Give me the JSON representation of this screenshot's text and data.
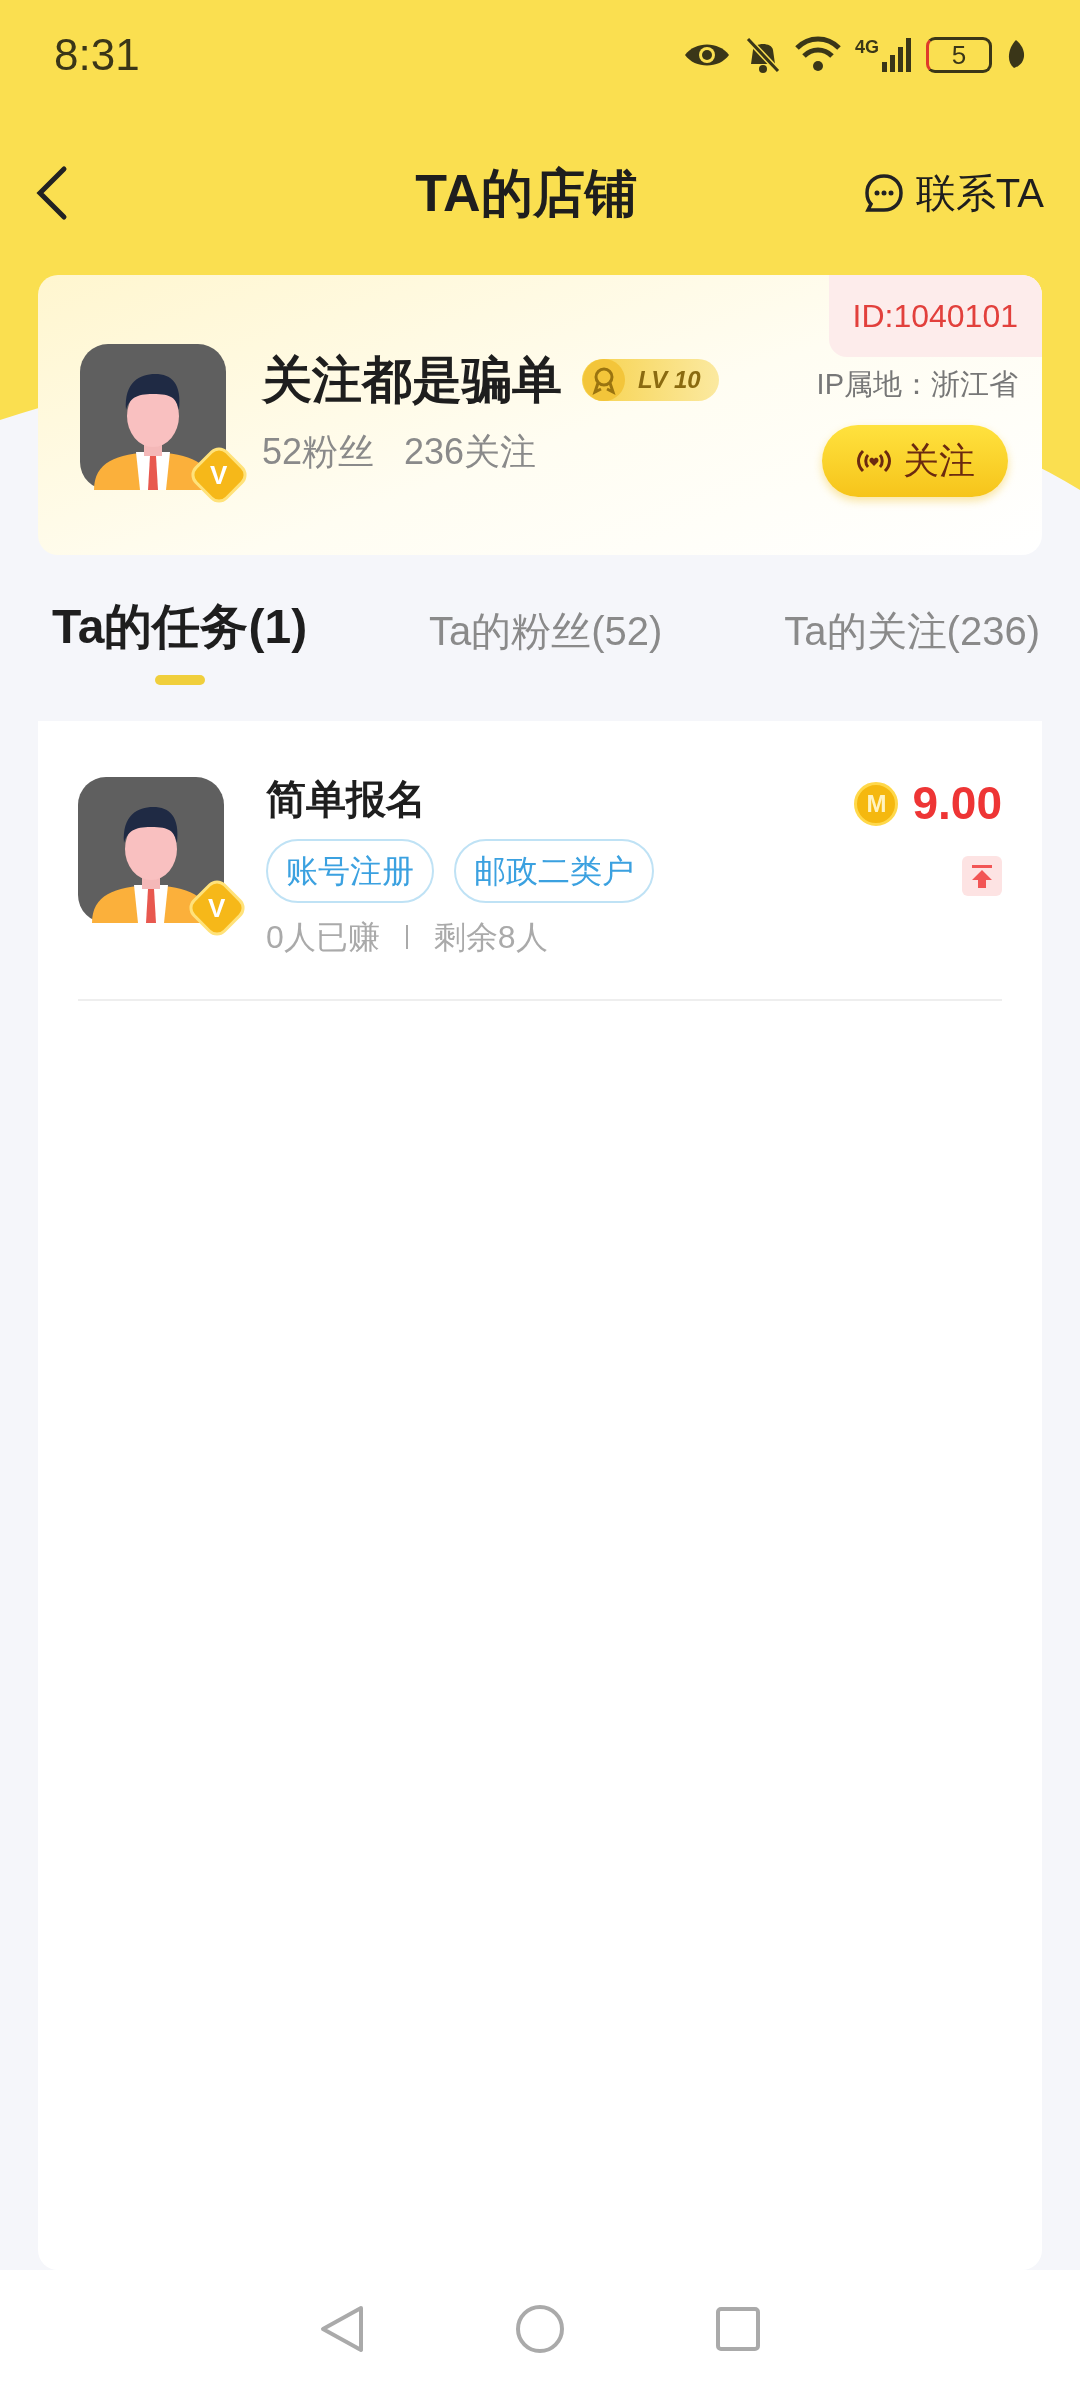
{
  "status_bar": {
    "time": "8:31",
    "network": "4G",
    "battery": "5"
  },
  "nav": {
    "title": "TA的店铺",
    "contact": "联系TA"
  },
  "profile": {
    "name": "关注都是骗单",
    "avatar_badge": "V",
    "level": "LV 10",
    "fans": "52粉丝",
    "following": "236关注",
    "id": "ID:1040101",
    "ip": "IP属地：浙江省",
    "follow_button": "关注"
  },
  "tabs": [
    {
      "label": "Ta的任务(1)",
      "selected": true
    },
    {
      "label": "Ta的粉丝(52)",
      "selected": false
    },
    {
      "label": "Ta的关注(236)",
      "selected": false
    }
  ],
  "tasks": [
    {
      "title": "简单报名",
      "avatar_badge": "V",
      "tags": [
        "账号注册",
        "邮政二类户"
      ],
      "earned": "0人已赚",
      "remaining": "剩余8人",
      "coin": "M",
      "price": "9.00",
      "pinned": true
    }
  ]
}
